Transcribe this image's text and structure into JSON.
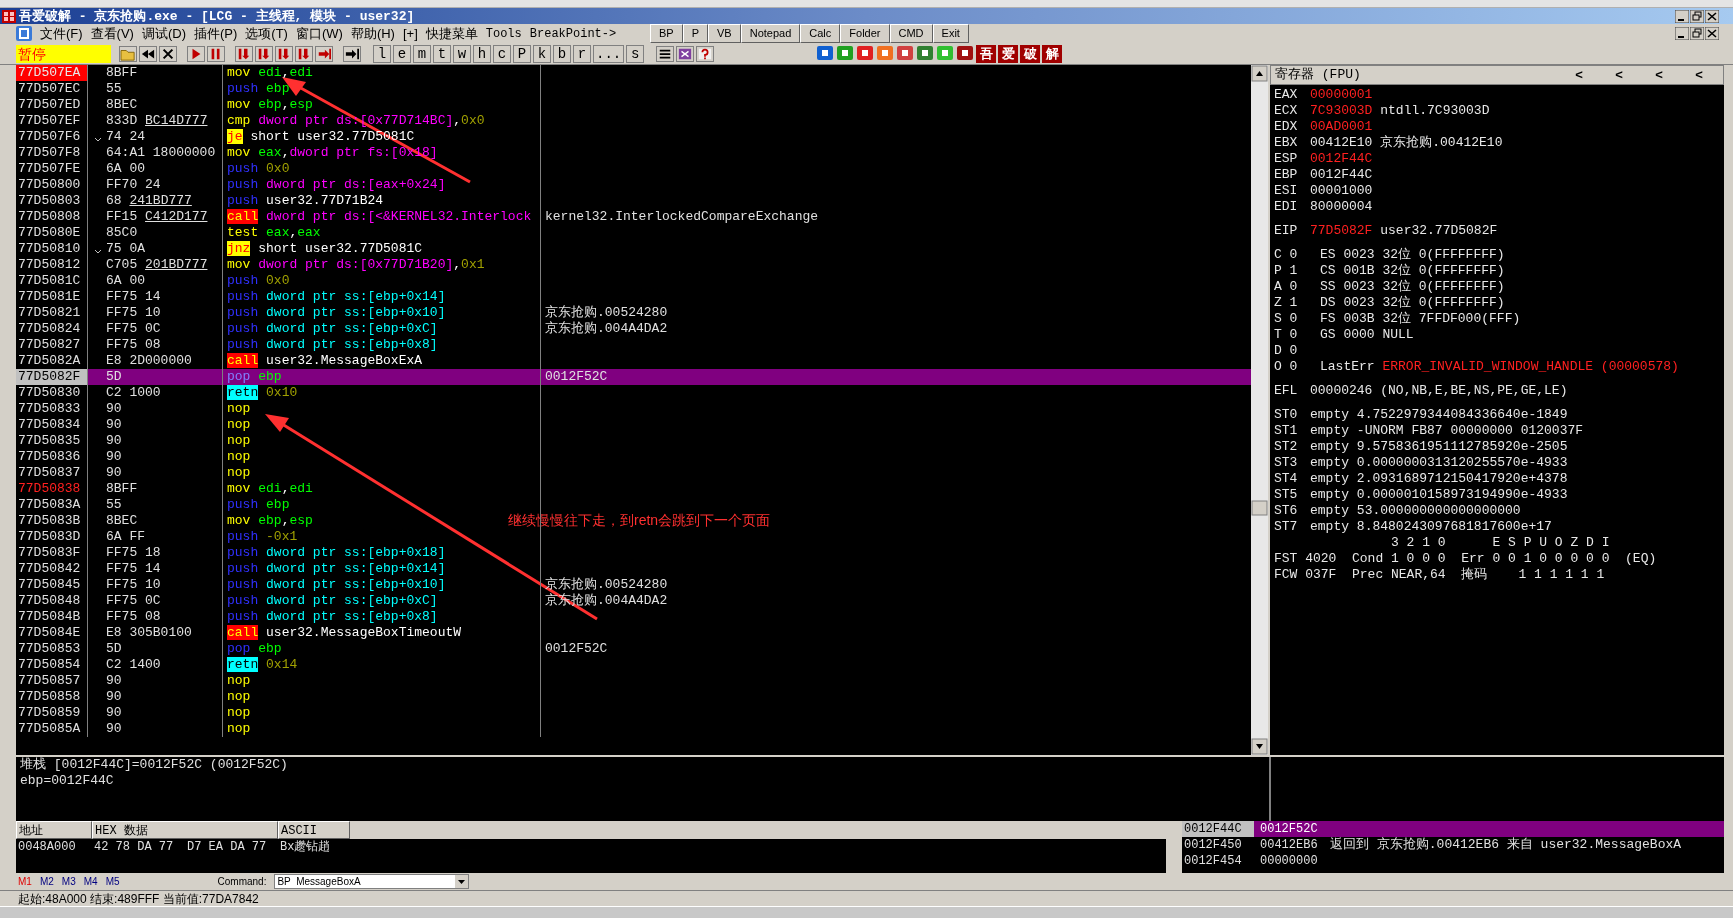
{
  "window": {
    "title": "吾爱破解 - 京东抢购.exe - [LCG - 主线程, 模块 - user32]"
  },
  "menu": [
    "文件(F)",
    "查看(V)",
    "调试(D)",
    "插件(P)",
    "选项(T)",
    "窗口(W)",
    "帮助(H)",
    "[+]",
    "快捷菜单",
    "Tools",
    "BreakPoint->"
  ],
  "toolbar": {
    "status": "暂停",
    "icons": [
      {
        "kind": "open"
      },
      {
        "kind": "rewind"
      },
      {
        "kind": "close"
      },
      {
        "kind": "play"
      },
      {
        "kind": "pause"
      },
      {
        "kind": "step"
      },
      {
        "kind": "step"
      },
      {
        "kind": "step"
      },
      {
        "kind": "step"
      },
      {
        "kind": "return"
      },
      {
        "kind": "goto"
      }
    ],
    "letters": [
      "l",
      "e",
      "m",
      "t",
      "w",
      "h",
      "c",
      "P",
      "k",
      "b",
      "r",
      "...",
      "s"
    ],
    "tools": [
      {
        "kind": "list"
      },
      {
        "kind": "grid"
      },
      {
        "kind": "help"
      }
    ],
    "color_icons": [
      {
        "color": "#1060d0"
      },
      {
        "color": "#20a020"
      },
      {
        "color": "#e02020"
      },
      {
        "color": "#f07020"
      },
      {
        "color": "#d04040"
      },
      {
        "color": "#308030"
      },
      {
        "color": "#30c030"
      },
      {
        "color": "#a01010"
      }
    ],
    "brand_tiles": [
      "吾",
      "爱",
      "破",
      "解"
    ]
  },
  "floating_toolbar": [
    "BP",
    "P",
    "VB",
    "Notepad",
    "Calc",
    "Folder",
    "CMD",
    "Exit"
  ],
  "disassembly": [
    {
      "address": "77D507EA",
      "breakpoint": true,
      "selected": false,
      "hex": "8BFF",
      "mnemonic": "mov",
      "kind": "mov",
      "operands": [
        {
          "text": "edi",
          "kind": "reg"
        },
        {
          "text": ",",
          "kind": "plain"
        },
        {
          "text": "edi",
          "kind": "reg"
        }
      ]
    },
    {
      "address": "77D507EC",
      "selected": false,
      "hex": "55",
      "mnemonic": "push",
      "kind": "push",
      "operands": [
        {
          "text": "ebp",
          "kind": "reg"
        }
      ]
    },
    {
      "address": "77D507ED",
      "selected": false,
      "hex": "8BEC",
      "mnemonic": "mov",
      "kind": "mov",
      "operands": [
        {
          "text": "ebp",
          "kind": "reg"
        },
        {
          "text": ",",
          "kind": "plain"
        },
        {
          "text": "esp",
          "kind": "reg"
        }
      ]
    },
    {
      "address": "77D507EF",
      "selected": false,
      "hex": "833D",
      "hex_fixup": "BC14D777",
      "mnemonic": "cmp",
      "kind": "mov",
      "operands": [
        {
          "text": "dword ptr ds:[0x77D714BC]",
          "kind": "mem"
        },
        {
          "text": ",",
          "kind": "plain"
        },
        {
          "text": "0x0",
          "kind": "const"
        }
      ]
    },
    {
      "address": "77D507F6",
      "selected": false,
      "jump": true,
      "hex": "74 24",
      "mnemonic": "je",
      "kind": "jump",
      "operands": [
        {
          "text": "short user32.77D5081C",
          "kind": "plain"
        }
      ]
    },
    {
      "address": "77D507F8",
      "selected": false,
      "hex": "64:A1 18000000",
      "mnemonic": "mov",
      "kind": "mov",
      "operands": [
        {
          "text": "eax",
          "kind": "reg"
        },
        {
          "text": ",",
          "kind": "plain"
        },
        {
          "text": "dword ptr fs:[0x18]",
          "kind": "mem"
        }
      ]
    },
    {
      "address": "77D507FE",
      "selected": false,
      "hex": "6A 00",
      "mnemonic": "push",
      "kind": "push",
      "operands": [
        {
          "text": "0x0",
          "kind": "const"
        }
      ]
    },
    {
      "address": "77D50800",
      "selected": false,
      "hex": "FF70 24",
      "mnemonic": "push",
      "kind": "push",
      "operands": [
        {
          "text": "dword ptr ds:[eax+0x24]",
          "kind": "mem"
        }
      ]
    },
    {
      "address": "77D50803",
      "selected": false,
      "hex": "68",
      "hex_fixup": "241BD777",
      "mnemonic": "push",
      "kind": "push",
      "operands": [
        {
          "text": "user32.77D71B24",
          "kind": "plain"
        }
      ]
    },
    {
      "address": "77D50808",
      "selected": false,
      "hex": "FF15",
      "hex_fixup": "C412D177",
      "mnemonic": "call",
      "kind": "call",
      "operands": [
        {
          "text": "dword ptr ds:[<&KERNEL32.Interlock",
          "kind": "mem"
        }
      ],
      "comment": "kernel32.InterlockedCompareExchange"
    },
    {
      "address": "77D5080E",
      "selected": false,
      "hex": "85C0",
      "mnemonic": "test",
      "kind": "mov",
      "operands": [
        {
          "text": "eax",
          "kind": "reg"
        },
        {
          "text": ",",
          "kind": "plain"
        },
        {
          "text": "eax",
          "kind": "reg"
        }
      ]
    },
    {
      "address": "77D50810",
      "selected": false,
      "jump": true,
      "hex": "75 0A",
      "mnemonic": "jnz",
      "kind": "jump",
      "operands": [
        {
          "text": "short user32.77D5081C",
          "kind": "plain"
        }
      ]
    },
    {
      "address": "77D50812",
      "selected": false,
      "hex": "C705",
      "hex_fixup": "201BD777",
      "mnemonic": "mov",
      "kind": "mov",
      "operands": [
        {
          "text": "dword ptr ds:[0x77D71B20]",
          "kind": "mem"
        },
        {
          "text": ",",
          "kind": "plain"
        },
        {
          "text": "0x1",
          "kind": "const"
        }
      ]
    },
    {
      "address": "77D5081C",
      "selected": false,
      "hex": "6A 00",
      "mnemonic": "push",
      "kind": "push",
      "operands": [
        {
          "text": "0x0",
          "kind": "const"
        }
      ]
    },
    {
      "address": "77D5081E",
      "selected": false,
      "hex": "FF75 14",
      "mnemonic": "push",
      "kind": "push",
      "operands": [
        {
          "text": "dword ptr ss:[ebp+0x14]",
          "kind": "stack"
        }
      ]
    },
    {
      "address": "77D50821",
      "selected": false,
      "hex": "FF75 10",
      "mnemonic": "push",
      "kind": "push",
      "operands": [
        {
          "text": "dword ptr ss:[ebp+0x10]",
          "kind": "stack"
        }
      ],
      "comment": "京东抢购.00524280"
    },
    {
      "address": "77D50824",
      "selected": false,
      "hex": "FF75 0C",
      "mnemonic": "push",
      "kind": "push",
      "operands": [
        {
          "text": "dword ptr ss:[ebp+0xC]",
          "kind": "stack"
        }
      ],
      "comment": "京东抢购.004A4DA2"
    },
    {
      "address": "77D50827",
      "selected": false,
      "hex": "FF75 08",
      "mnemonic": "push",
      "kind": "push",
      "operands": [
        {
          "text": "dword ptr ss:[ebp+0x8]",
          "kind": "stack"
        }
      ]
    },
    {
      "address": "77D5082A",
      "selected": false,
      "hex": "E8 2D000000",
      "mnemonic": "call",
      "kind": "call",
      "operands": [
        {
          "text": "user32.MessageBoxExA",
          "kind": "plain"
        }
      ]
    },
    {
      "address": "77D5082F",
      "selected": true,
      "hex": "5D",
      "mnemonic": "pop",
      "kind": "push",
      "operands": [
        {
          "text": "ebp",
          "kind": "reg"
        }
      ],
      "comment": "0012F52C"
    },
    {
      "address": "77D50830",
      "selected": false,
      "hex": "C2 1000",
      "mnemonic": "retn",
      "kind": "ret",
      "operands": [
        {
          "text": "0x10",
          "kind": "const"
        }
      ]
    },
    {
      "address": "77D50833",
      "selected": false,
      "hex": "90",
      "mnemonic": "nop",
      "kind": "mov"
    },
    {
      "address": "77D50834",
      "selected": false,
      "hex": "90",
      "mnemonic": "nop",
      "kind": "mov"
    },
    {
      "address": "77D50835",
      "selected": false,
      "hex": "90",
      "mnemonic": "nop",
      "kind": "mov"
    },
    {
      "address": "77D50836",
      "selected": false,
      "hex": "90",
      "mnemonic": "nop",
      "kind": "mov"
    },
    {
      "address": "77D50837",
      "selected": false,
      "hex": "90",
      "mnemonic": "nop",
      "kind": "mov"
    },
    {
      "address": "77D50838",
      "label_start": true,
      "selected": false,
      "hex": "8BFF",
      "mnemonic": "mov",
      "kind": "mov",
      "operands": [
        {
          "text": "edi",
          "kind": "reg"
        },
        {
          "text": ",",
          "kind": "plain"
        },
        {
          "text": "edi",
          "kind": "reg"
        }
      ]
    },
    {
      "address": "77D5083A",
      "selected": false,
      "hex": "55",
      "mnemonic": "push",
      "kind": "push",
      "operands": [
        {
          "text": "ebp",
          "kind": "reg"
        }
      ]
    },
    {
      "address": "77D5083B",
      "selected": false,
      "hex": "8BEC",
      "mnemonic": "mov",
      "kind": "mov",
      "operands": [
        {
          "text": "ebp",
          "kind": "reg"
        },
        {
          "text": ",",
          "kind": "plain"
        },
        {
          "text": "esp",
          "kind": "reg"
        }
      ]
    },
    {
      "address": "77D5083D",
      "selected": false,
      "hex": "6A FF",
      "mnemonic": "push",
      "kind": "push",
      "operands": [
        {
          "text": "-0x1",
          "kind": "const"
        }
      ]
    },
    {
      "address": "77D5083F",
      "selected": false,
      "hex": "FF75 18",
      "mnemonic": "push",
      "kind": "push",
      "operands": [
        {
          "text": "dword ptr ss:[ebp+0x18]",
          "kind": "stack"
        }
      ]
    },
    {
      "address": "77D50842",
      "selected": false,
      "hex": "FF75 14",
      "mnemonic": "push",
      "kind": "push",
      "operands": [
        {
          "text": "dword ptr ss:[ebp+0x14]",
          "kind": "stack"
        }
      ]
    },
    {
      "address": "77D50845",
      "selected": false,
      "hex": "FF75 10",
      "mnemonic": "push",
      "kind": "push",
      "operands": [
        {
          "text": "dword ptr ss:[ebp+0x10]",
          "kind": "stack"
        }
      ],
      "comment": "京东抢购.00524280"
    },
    {
      "address": "77D50848",
      "selected": false,
      "hex": "FF75 0C",
      "mnemonic": "push",
      "kind": "push",
      "operands": [
        {
          "text": "dword ptr ss:[ebp+0xC]",
          "kind": "stack"
        }
      ],
      "comment": "京东抢购.004A4DA2"
    },
    {
      "address": "77D5084B",
      "selected": false,
      "hex": "FF75 08",
      "mnemonic": "push",
      "kind": "push",
      "operands": [
        {
          "text": "dword ptr ss:[ebp+0x8]",
          "kind": "stack"
        }
      ]
    },
    {
      "address": "77D5084E",
      "selected": false,
      "hex": "E8 305B0100",
      "mnemonic": "call",
      "kind": "call",
      "operands": [
        {
          "text": "user32.MessageBoxTimeoutW",
          "kind": "plain"
        }
      ]
    },
    {
      "address": "77D50853",
      "selected": false,
      "hex": "5D",
      "mnemonic": "pop",
      "kind": "push",
      "operands": [
        {
          "text": "ebp",
          "kind": "reg"
        }
      ],
      "comment": "0012F52C"
    },
    {
      "address": "77D50854",
      "selected": false,
      "hex": "C2 1400",
      "mnemonic": "retn",
      "kind": "ret",
      "operands": [
        {
          "text": "0x14",
          "kind": "const"
        }
      ]
    },
    {
      "address": "77D50857",
      "selected": false,
      "hex": "90",
      "mnemonic": "nop",
      "kind": "mov"
    },
    {
      "address": "77D50858",
      "selected": false,
      "hex": "90",
      "mnemonic": "nop",
      "kind": "mov"
    },
    {
      "address": "77D50859",
      "selected": false,
      "hex": "90",
      "mnemonic": "nop",
      "kind": "mov"
    },
    {
      "address": "77D5085A",
      "selected": false,
      "hex": "90",
      "mnemonic": "nop",
      "kind": "mov"
    }
  ],
  "annotation": {
    "text": "继续慢慢往下走，到retn会跳到下一个页面"
  },
  "registers": {
    "title": "寄存器 (FPU)",
    "nav": [
      "<",
      "<",
      "<",
      "<"
    ],
    "groups": [
      {
        "kind": "gpr",
        "lines": [
          {
            "label": "EAX",
            "value": "00000001",
            "changed": true
          },
          {
            "label": "ECX",
            "value": "7C93003D",
            "changed": true,
            "note": "ntdll.7C93003D"
          },
          {
            "label": "EDX",
            "value": "00AD0001",
            "changed": true
          },
          {
            "label": "EBX",
            "value": "00412E10",
            "changed": false,
            "note": "京东抢购.00412E10"
          },
          {
            "label": "ESP",
            "value": "0012F44C",
            "changed": true
          },
          {
            "label": "EBP",
            "value": "0012F44C",
            "changed": false
          },
          {
            "label": "ESI",
            "value": "00001000",
            "changed": false
          },
          {
            "label": "EDI",
            "value": "80000004",
            "changed": false
          }
        ]
      },
      {
        "kind": "gpr",
        "lines": [
          {
            "label": "EIP",
            "value": "77D5082F",
            "changed": true,
            "note": "user32.77D5082F"
          }
        ]
      },
      {
        "kind": "flags",
        "lines": [
          {
            "label": "C 0",
            "value": "ES 0023 32位 0(FFFFFFFF)",
            "changed": false
          },
          {
            "label": "P 1",
            "value": "CS 001B 32位 0(FFFFFFFF)",
            "changed": false
          },
          {
            "label": "A 0",
            "value": "SS 0023 32位 0(FFFFFFFF)",
            "changed": false
          },
          {
            "label": "Z 1",
            "value": "DS 0023 32位 0(FFFFFFFF)",
            "changed": false
          },
          {
            "label": "S 0",
            "value": "FS 003B 32位 7FFDF000(FFF)",
            "changed": false
          },
          {
            "label": "T 0",
            "value": "GS 0000 NULL",
            "changed": false
          },
          {
            "label": "D 0"
          },
          {
            "label": "O 0",
            "value": "LastErr",
            "changed": false,
            "note": "ERROR_INVALID_WINDOW_HANDLE (00000578)",
            "note_alert": true
          }
        ]
      },
      {
        "kind": "gpr",
        "lines": [
          {
            "label": "EFL",
            "value": "00000246",
            "changed": false,
            "note": "(NO,NB,E,BE,NS,PE,GE,LE)"
          }
        ]
      },
      {
        "kind": "gpr",
        "lines": [
          {
            "label": "ST0",
            "value": "empty",
            "changed": false,
            "note": "4.7522979344084336640e-1849"
          },
          {
            "label": "ST1",
            "value": "empty",
            "changed": false,
            "note": "-UNORM FB87 00000000 0120037F"
          },
          {
            "label": "ST2",
            "value": "empty",
            "changed": false,
            "note": "9.5758361951112785920e-2505"
          },
          {
            "label": "ST3",
            "value": "empty",
            "changed": false,
            "note": "0.0000000313120255570e-4933"
          },
          {
            "label": "ST4",
            "value": "empty",
            "changed": false,
            "note": "2.0931689712150417920e+4378"
          },
          {
            "label": "ST5",
            "value": "empty",
            "changed": false,
            "note": "0.0000010158973194990e-4933"
          },
          {
            "label": "ST6",
            "value": "empty",
            "changed": false,
            "note": "53.000000000000000000"
          },
          {
            "label": "ST7",
            "value": "empty",
            "changed": false,
            "note": "8.8480243097681817600e+17"
          }
        ]
      }
    ],
    "fpu_status": [
      "               3 2 1 0      E S P U O Z D I",
      "FST 4020  Cond 1 0 0 0  Err 0 0 1 0 0 0 0 0  (EQ)",
      "FCW 037F  Prec NEAR,64  掩码    1 1 1 1 1 1"
    ]
  },
  "info": [
    "堆栈 [0012F44C]=0012F52C (0012F52C)",
    "ebp=0012F44C"
  ],
  "dump": {
    "columns": [
      "地址",
      "HEX 数据",
      "ASCII"
    ],
    "rows": [
      {
        "address": "0048A000",
        "hex1": "42 78 DA 77",
        "hex2": "D7 EA DA 77",
        "ascii": "Bx趱钻趙"
      }
    ]
  },
  "stack": [
    {
      "address": "0012F44C",
      "value": "0012F52C",
      "selected": true
    },
    {
      "address": "0012F450",
      "value": "00412EB6",
      "selected": false,
      "comment": "返回到 京东抢购.00412EB6 来自 user32.MessageBoxA"
    },
    {
      "address": "0012F454",
      "value": "00000000",
      "selected": false
    }
  ],
  "command_bar": {
    "tabs": [
      "M1",
      "M2",
      "M3",
      "M4",
      "M5"
    ],
    "label": "Command:",
    "value": "BP  MessageBoxA"
  },
  "status_bar": "起始:48A000 结束:489FFF 当前值:77DA7842"
}
